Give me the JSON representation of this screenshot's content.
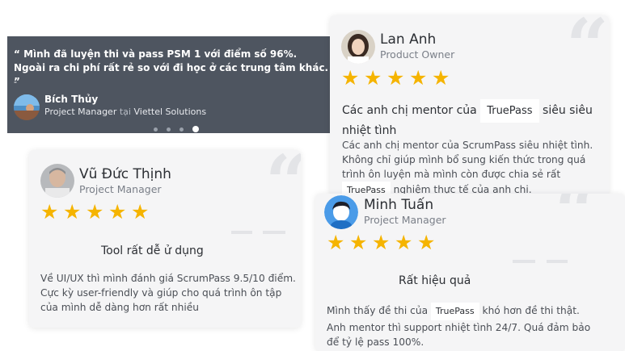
{
  "slider": {
    "quote": "“ Mình đã luyện thi và pass PSM 1 với điểm số 96%. Ngoài ra chi phí rất rẻ so với đi học ở các trung tâm khác. ”",
    "dash": "-",
    "name": "Bích Thủy",
    "role": "Project Manager",
    "at": "tại",
    "company": "Viettel Solutions",
    "dots": 4,
    "active_dot": 4
  },
  "cards": {
    "lan_anh": {
      "name": "Lan Anh",
      "role": "Product Owner",
      "rating": 5,
      "headline_before": "Các anh chị mentor của",
      "headline_brand": "TruePass",
      "headline_after": "siêu siêu nhiệt tình",
      "body_1": "Các anh chị mentor của ScrumPass siêu nhiệt tình. Không chỉ giúp mình bổ sung kiến thức trong quá trình ôn luyện mà mình còn được chia sẻ rất",
      "body_brand": "TruePass",
      "body_2": "nghiệm thực tế của anh chị."
    },
    "vu_duc_thinh": {
      "name": "Vũ Đức Thịnh",
      "role": "Project Manager",
      "rating": 5,
      "headline": "Tool rất dễ ử dụng",
      "body": "Về UI/UX thì mình đánh giá ScrumPass 9.5/10 điểm. Cực kỳ user-friendly và giúp cho quá trình ôn tập của mình dễ dàng hơn rất nhiều"
    },
    "minh_tuan": {
      "name": "Minh Tuấn",
      "role": "Project Manager",
      "rating": 5,
      "headline": "Rất hiệu quả",
      "body_1": "Mình thấy đề thi của",
      "body_brand": "TruePass",
      "body_2": "khó hơn đề thi thật. Anh mentor thì support nhiệt tình 24/7. Quá đảm bảo để tỷ lệ pass 100%."
    }
  },
  "icons": {
    "star": "★",
    "quote": "❝"
  },
  "colors": {
    "star": "#f5b400",
    "slider_bg": "#4e5560",
    "card_bg": "#f5f5f6"
  }
}
